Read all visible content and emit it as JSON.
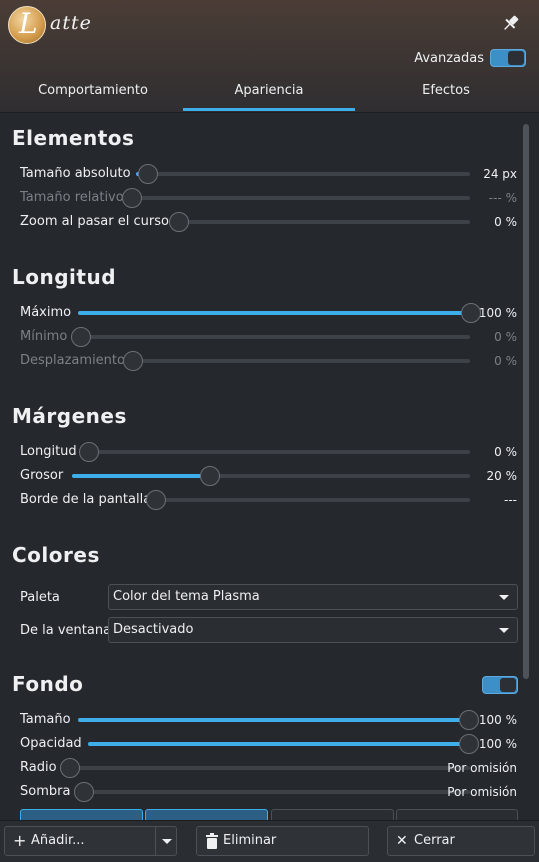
{
  "header": {
    "logo_letter": "L",
    "brand": "atte",
    "advanced_label": "Avanzadas",
    "advanced_on": true
  },
  "tabs": [
    {
      "label": "Comportamiento",
      "active": false
    },
    {
      "label": "Apariencia",
      "active": true
    },
    {
      "label": "Efectos",
      "active": false
    }
  ],
  "sections": {
    "elementos": {
      "title": "Elementos",
      "rows": [
        {
          "label": "Tamaño absoluto",
          "value": "24 px",
          "level": 0.03,
          "disabled": false
        },
        {
          "label": "Tamaño relativo",
          "value": "--- %",
          "level": 0.0,
          "disabled": true
        },
        {
          "label": "Zoom al pasar el cursor",
          "value": "0 %",
          "level": 0.0,
          "disabled": false
        }
      ]
    },
    "longitud": {
      "title": "Longitud",
      "rows": [
        {
          "label": "Máximo",
          "value": "100 %",
          "level": 1.0,
          "disabled": false
        },
        {
          "label": "Mínimo",
          "value": "0 %",
          "level": 0.0,
          "disabled": true
        },
        {
          "label": "Desplazamiento",
          "value": "0 %",
          "level": 0.0,
          "disabled": true
        }
      ]
    },
    "margenes": {
      "title": "Márgenes",
      "rows": [
        {
          "label": "Longitud",
          "value": "0 %",
          "level": 0.0,
          "disabled": false
        },
        {
          "label": "Grosor",
          "value": "20 %",
          "level": 0.35,
          "disabled": false
        },
        {
          "label": "Borde de la pantalla",
          "value": "---",
          "level": 0.0,
          "disabled": false
        }
      ]
    },
    "colores": {
      "title": "Colores",
      "rows": [
        {
          "label": "Paleta",
          "selected": "Color del tema Plasma"
        },
        {
          "label": "De la ventana",
          "selected": "Desactivado"
        }
      ]
    },
    "fondo": {
      "title": "Fondo",
      "enabled": true,
      "rows": [
        {
          "label": "Tamaño",
          "value": "100 %",
          "level": 1.0,
          "disabled": false
        },
        {
          "label": "Opacidad",
          "value": "100 %",
          "level": 1.0,
          "disabled": false
        },
        {
          "label": "Radio",
          "value": "Por omisión",
          "level": 0.0,
          "disabled": false
        },
        {
          "label": "Sombra",
          "value": "Por omisión",
          "level": 0.0,
          "disabled": false
        }
      ]
    }
  },
  "footer": {
    "add_label": "Añadir...",
    "remove_label": "Eliminar",
    "close_label": "Cerrar"
  },
  "colors": {
    "accent": "#3daee9",
    "background": "#25282d"
  }
}
